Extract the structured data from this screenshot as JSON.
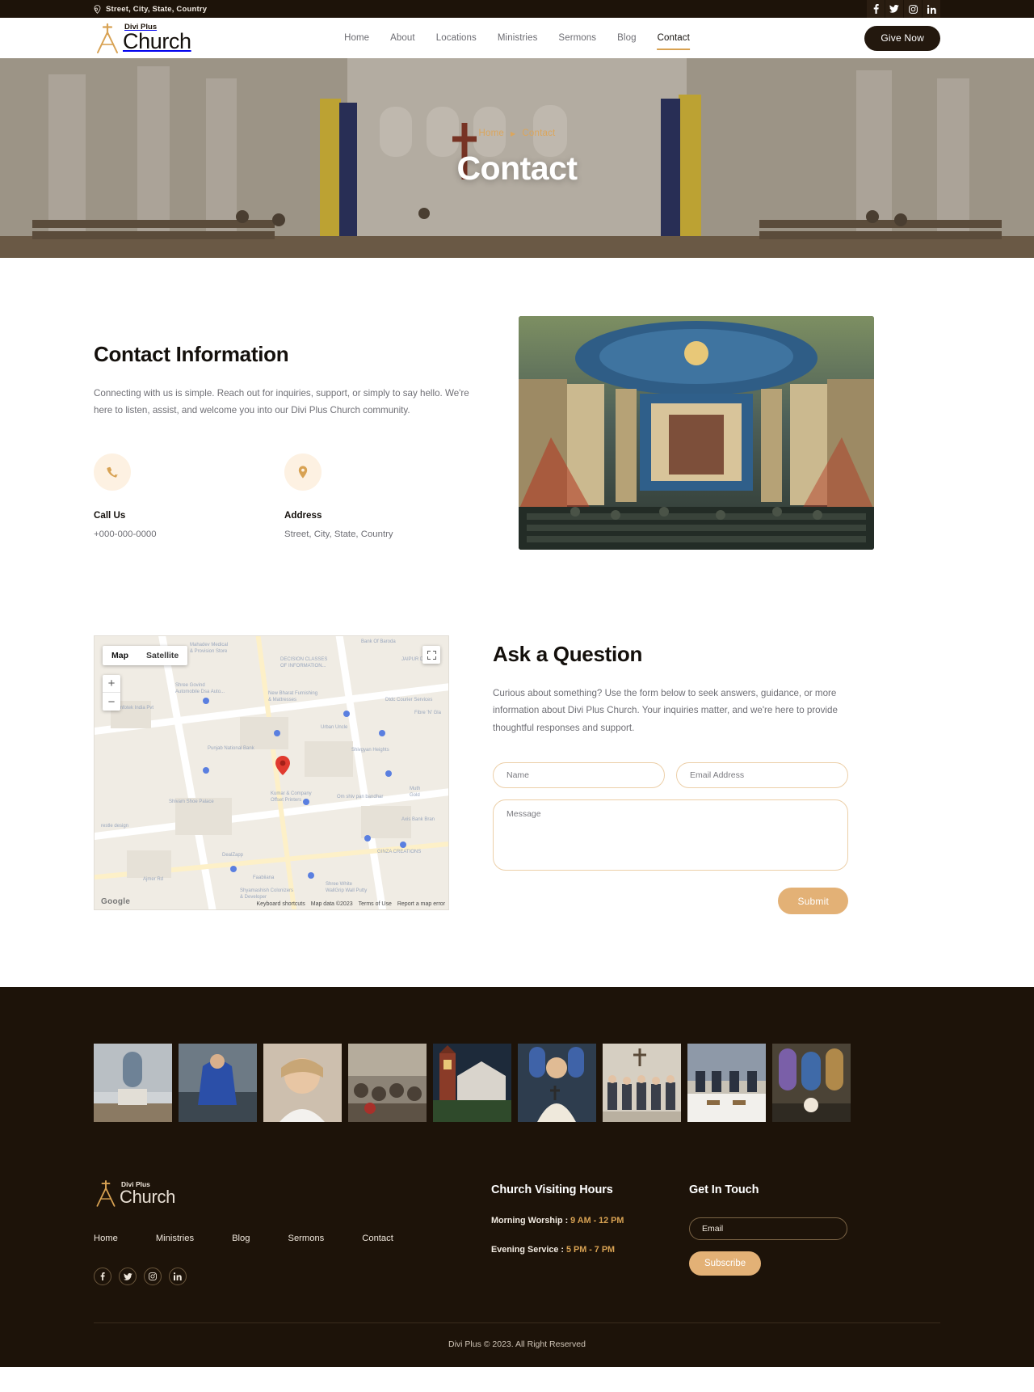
{
  "topbar": {
    "address": "Street, City, State, Country",
    "location_icon": "map-pin-icon",
    "social": [
      {
        "name": "facebook-icon",
        "label": "f"
      },
      {
        "name": "twitter-icon",
        "label": "t"
      },
      {
        "name": "instagram-icon",
        "label": "ig"
      },
      {
        "name": "linkedin-icon",
        "label": "in"
      }
    ]
  },
  "header": {
    "logo_sub": "Divi Plus",
    "logo_main": "Church",
    "logo_icon": "church-steeple-cross-icon",
    "nav": [
      {
        "label": "Home",
        "active": false
      },
      {
        "label": "About",
        "active": false
      },
      {
        "label": "Locations",
        "active": false
      },
      {
        "label": "Ministries",
        "active": false
      },
      {
        "label": "Sermons",
        "active": false
      },
      {
        "label": "Blog",
        "active": false
      },
      {
        "label": "Contact",
        "active": true
      }
    ],
    "cta": "Give Now"
  },
  "hero": {
    "breadcrumb_home": "Home",
    "breadcrumb_sep": "▶",
    "breadcrumb_current": "Contact",
    "title": "Contact"
  },
  "contact_info": {
    "heading": "Contact Information",
    "paragraph": "Connecting with us is simple. Reach out for inquiries, support, or simply to say hello. We're here to listen, assist, and welcome you into our Divi Plus Church community.",
    "items": [
      {
        "icon": "phone-icon",
        "label": "Call Us",
        "value": "+000-000-0000"
      },
      {
        "icon": "map-pin-icon",
        "label": "Address",
        "value": "Street, City, State, Country"
      }
    ]
  },
  "map": {
    "toggle": [
      {
        "label": "Map",
        "selected": true
      },
      {
        "label": "Satellite",
        "selected": false
      }
    ],
    "zoom_in": "+",
    "zoom_out": "−",
    "fullscreen_icon": "fullscreen-icon",
    "marker_icon": "map-marker-icon",
    "credit": "Google",
    "footer_links": [
      "Keyboard shortcuts",
      "Map data ©2023",
      "Terms of Use",
      "Report a map error"
    ]
  },
  "form": {
    "heading": "Ask a Question",
    "paragraph": "Curious about something? Use the form below to seek answers, guidance, or more information about Divi Plus Church. Your inquiries matter, and we're here to provide thoughtful responses and support.",
    "name_placeholder": "Name",
    "email_placeholder": "Email Address",
    "message_placeholder": "Message",
    "submit": "Submit"
  },
  "footer": {
    "gallery_count": 9,
    "logo_sub": "Divi Plus",
    "logo_main": "Church",
    "nav": [
      "Home",
      "Ministries",
      "Blog",
      "Sermons",
      "Contact"
    ],
    "social": [
      {
        "name": "facebook-icon"
      },
      {
        "name": "twitter-icon"
      },
      {
        "name": "instagram-icon"
      },
      {
        "name": "linkedin-icon"
      }
    ],
    "hours_heading": "Church Visiting Hours",
    "hours": [
      {
        "label": "Morning Worship :",
        "time": "9 AM - 12 PM"
      },
      {
        "label": "Evening Service :",
        "time": "5 PM - 7 PM"
      }
    ],
    "touch_heading": "Get In Touch",
    "email_placeholder": "Email",
    "subscribe": "Subscribe",
    "copyright": "Divi Plus © 2023. All Right Reserved"
  },
  "colors": {
    "dark": "#1d1309",
    "gold": "#d8a253",
    "accent_button": "#e3b176",
    "field_border": "#eccfa8"
  }
}
